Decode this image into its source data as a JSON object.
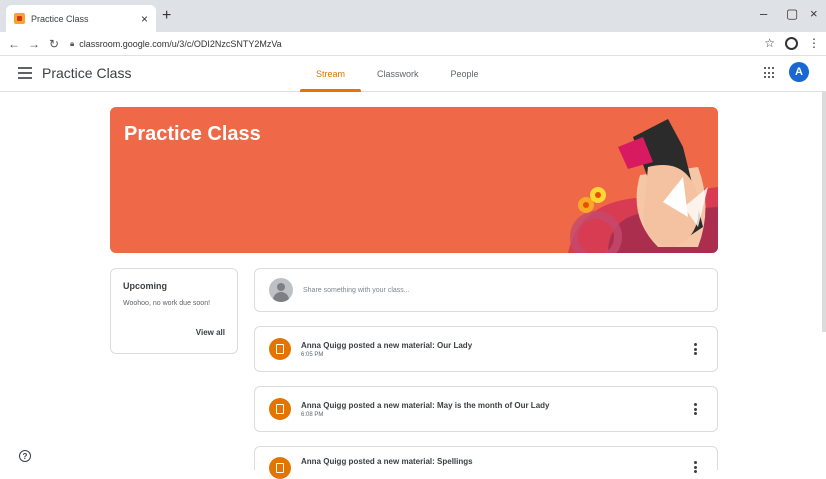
{
  "browser": {
    "tab_title": "Practice Class",
    "tab_close": "×",
    "new_tab": "+",
    "url": "classroom.google.com/u/3/c/ODI2NzcSNTY2MzVa",
    "win_min": "–",
    "win_max": "▢",
    "win_close": "×"
  },
  "app": {
    "class_name": "Practice Class",
    "tabs": [
      {
        "label": "Stream",
        "active": true
      },
      {
        "label": "Classwork",
        "active": false
      },
      {
        "label": "People",
        "active": false
      }
    ],
    "avatar_letter": "A"
  },
  "banner": {
    "title": "Practice Class",
    "color": "#ef6848"
  },
  "upcoming": {
    "title": "Upcoming",
    "empty_text": "Woohoo, no work due soon!",
    "view_all": "View all"
  },
  "share": {
    "placeholder": "Share something with your class..."
  },
  "posts": [
    {
      "title": "Anna Quigg posted a new material: Our Lady",
      "time": "6:05 PM"
    },
    {
      "title": "Anna Quigg posted a new material: May is the month of Our Lady",
      "time": "6:08 PM"
    },
    {
      "title": "Anna Quigg posted a new material: Spellings",
      "time": ""
    }
  ],
  "colors": {
    "accent": "#e37400",
    "avatar": "#1967d2"
  }
}
